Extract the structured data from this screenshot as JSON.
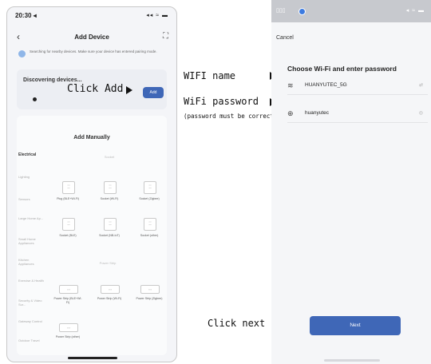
{
  "left_phone": {
    "status_time": "20:30 ◂",
    "status_icons": "◂◂ ≈ ▬",
    "back_glyph": "‹",
    "title": "Add Device",
    "expand_glyph": "⛶",
    "search_info": "Searching for nearby devices. Make sure your device has entered pairing mode.",
    "discovering_label": "Discovering devices...",
    "add_button": "Add",
    "add_manually_title": "Add Manually",
    "sidebar_categories": [
      {
        "label": "Electrical"
      },
      {
        "label": "Lighting"
      },
      {
        "label": "Sensors"
      },
      {
        "label": "Large Home Ap..."
      },
      {
        "label": "Small Home Appliances"
      },
      {
        "label": "Kitchen Appliances"
      },
      {
        "label": "Exercise & Health"
      },
      {
        "label": "Security & Video Sur..."
      },
      {
        "label": "Gateway Control"
      },
      {
        "label": "Outdoor Travel"
      }
    ],
    "socket_header": "Socket",
    "power_strip_header": "Power Strip",
    "sockets": [
      {
        "label": "Plug (BLE+Wi-Fi)"
      },
      {
        "label": "Socket (Wi-Fi)"
      },
      {
        "label": "Socket (Zigbee)"
      },
      {
        "label": "Socket (BLE)"
      },
      {
        "label": "Socket (NB-IoT)"
      },
      {
        "label": "Socket (other)"
      }
    ],
    "power_strips": [
      {
        "label": "Power Strip (BLE+Wi-Fi)"
      },
      {
        "label": "Power Strip (Wi-Fi)"
      },
      {
        "label": "Power Strip (Zigbee)"
      },
      {
        "label": "Power Strip (other)"
      }
    ]
  },
  "annotations": {
    "click_add": "Click Add",
    "wifi_name": "WIFI name",
    "wifi_password": "WiFi password",
    "password_note": "(password must be correct)",
    "click_next": "Click next"
  },
  "right_phone": {
    "status_time": "▯▯▯",
    "status_icons": "◂ ≈ ▬",
    "cancel": "Cancel",
    "title": "Choose Wi-Fi and enter password",
    "wifi_network": "HUANYUTEC_5G",
    "wifi_trailing": "⇄",
    "password_value": "huanyutec",
    "password_trailing": "◎",
    "next_button": "Next"
  },
  "colors": {
    "primary_button": "#3f67b7",
    "annotation_text": "#111111"
  }
}
